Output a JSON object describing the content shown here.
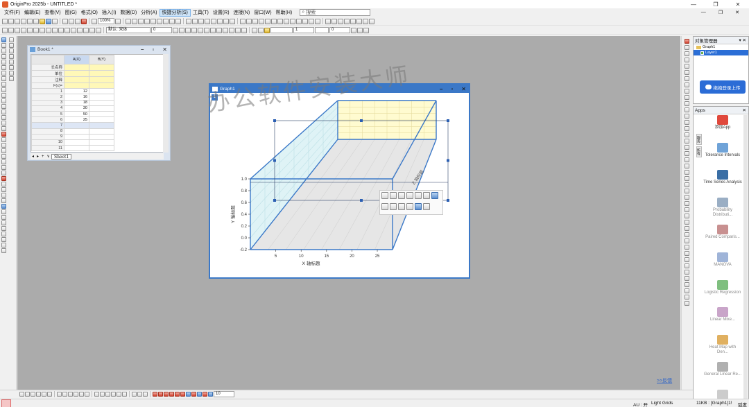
{
  "app": {
    "title": "OriginPro 2025b - UNTITLED *"
  },
  "menu": [
    {
      "label": "文件(F)"
    },
    {
      "label": "编辑(E)"
    },
    {
      "label": "查看(V)"
    },
    {
      "label": "图(G)"
    },
    {
      "label": "格式(O)"
    },
    {
      "label": "插入(I)"
    },
    {
      "label": "数据(D)"
    },
    {
      "label": "分析(A)"
    },
    {
      "label": "快捷分析(S)"
    },
    {
      "label": "工具(T)"
    },
    {
      "label": "设置(R)"
    },
    {
      "label": "连接(N)"
    },
    {
      "label": "窗口(W)"
    },
    {
      "label": "帮助(H)"
    }
  ],
  "search": {
    "placeholder": "搜索"
  },
  "toolbar": {
    "zoom": "100%",
    "font": "默认: 宋体",
    "font_size": "0",
    "line_width": "1",
    "size2": "0"
  },
  "book": {
    "title": "Book1 *",
    "columns": [
      "A(X)",
      "B(Y)"
    ],
    "meta_rows": [
      "长名称",
      "单位",
      "注释",
      "F(x)="
    ],
    "rows": [
      {
        "n": "1",
        "a": "12"
      },
      {
        "n": "2",
        "a": "16"
      },
      {
        "n": "3",
        "a": "18"
      },
      {
        "n": "4",
        "a": "30"
      },
      {
        "n": "5",
        "a": "50"
      },
      {
        "n": "6",
        "a": "25"
      },
      {
        "n": "7",
        "a": ""
      },
      {
        "n": "8",
        "a": ""
      },
      {
        "n": "9",
        "a": ""
      },
      {
        "n": "10",
        "a": ""
      },
      {
        "n": "11",
        "a": ""
      }
    ],
    "sheet_tab": "Sheet1"
  },
  "graph": {
    "title": "Graph1",
    "layer_badge": "1"
  },
  "chart_data": {
    "type": "line",
    "title": "",
    "xlabel": "X 轴标题",
    "ylabel": "Y 轴标题",
    "zlabel": "Z 轴标题",
    "x_ticks": [
      "5",
      "10",
      "15",
      "20",
      "25"
    ],
    "y_ticks": [
      "-0.2",
      "0.0",
      "0.2",
      "0.4",
      "0.6",
      "0.8",
      "1.0"
    ],
    "xlim": [
      0,
      28
    ],
    "ylim": [
      -0.2,
      1.0
    ],
    "grid": true,
    "colors": {
      "axis": "#3a78c8",
      "back_wall": "#fffbd0",
      "side_wall": "#dff3f6",
      "floor": "#e6e6e6"
    },
    "series": []
  },
  "watermark": "办公软件安装大师",
  "feedback": ">>反馈",
  "object_manager": {
    "title": "对象管理器",
    "items": [
      {
        "label": "Graph1",
        "selected": false
      },
      {
        "label": "Layer1",
        "selected": true
      }
    ],
    "upload_label": "拖拽登录上传"
  },
  "apps": {
    "title": "Apps",
    "tabs": [
      "服务",
      "所有"
    ],
    "items": [
      {
        "label": "添加App",
        "icon": "add-app-icon",
        "color": "#e0483c",
        "dim": false
      },
      {
        "label": "Tolerance Intervals",
        "icon": "tolerance-icon",
        "color": "#6fa3d8",
        "dim": false
      },
      {
        "label": "Time Series Analysis",
        "icon": "clock-icon",
        "color": "#3a6ea5",
        "dim": false
      },
      {
        "label": "Probability Distributi...",
        "icon": "distribution-icon",
        "color": "#9aaec4",
        "dim": true
      },
      {
        "label": "Paired Comparis...",
        "icon": "paired-icon",
        "color": "#c89090",
        "dim": true
      },
      {
        "label": "MANOVA",
        "icon": "manova-icon",
        "color": "#9fb4d8",
        "dim": true
      },
      {
        "label": "Logistic Regression",
        "icon": "logistic-icon",
        "color": "#7fbf7f",
        "dim": true
      },
      {
        "label": "Linear Mixe...",
        "icon": "linear-mixed-icon",
        "color": "#c9a5c9",
        "dim": true
      },
      {
        "label": "Heat Map with Den...",
        "icon": "heatmap-icon",
        "color": "#e0b060",
        "dim": true
      },
      {
        "label": "General Linear Re...",
        "icon": "glm-icon",
        "color": "#b0b0b0",
        "dim": true
      },
      {
        "label": "",
        "icon": "more-app-icon",
        "color": "#cccccc",
        "dim": true
      }
    ]
  },
  "bottom_toolbar": {
    "value": "10"
  },
  "status": {
    "au": "AU : 开",
    "grid": "Light Grids",
    "info": "11KB : [Graph1]1!",
    "unit": "弧度"
  }
}
